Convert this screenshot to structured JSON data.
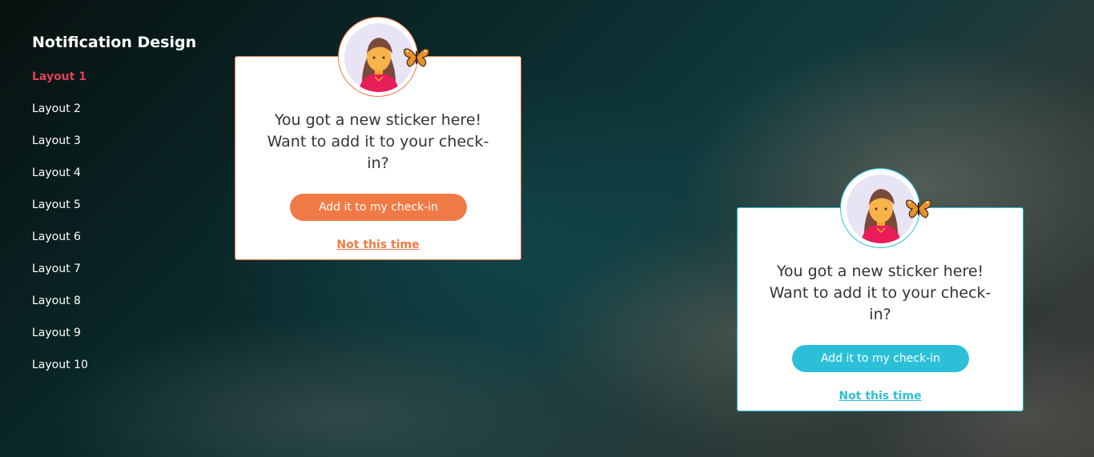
{
  "sidebar": {
    "title": "Notification Design",
    "items": [
      {
        "label": "Layout 1",
        "active": true
      },
      {
        "label": "Layout 2"
      },
      {
        "label": "Layout 3"
      },
      {
        "label": "Layout 4"
      },
      {
        "label": "Layout 5"
      },
      {
        "label": "Layout 6"
      },
      {
        "label": "Layout 7"
      },
      {
        "label": "Layout 8"
      },
      {
        "label": "Layout 9"
      },
      {
        "label": "Layout 10"
      }
    ]
  },
  "cards": [
    {
      "accent": "#f07a45",
      "message": "You got a new sticker here! Want to add it to your check-in?",
      "cta_label": "Add it to my check-in",
      "dismiss_label": "Not this time",
      "avatar_icon": "woman-avatar-icon",
      "sticker_icon": "butterfly-icon"
    },
    {
      "accent": "#2cc0d8",
      "message": "You got a new sticker here! Want to add it to your check-in?",
      "cta_label": "Add it to my check-in",
      "dismiss_label": "Not this time",
      "avatar_icon": "woman-avatar-icon",
      "sticker_icon": "butterfly-icon"
    }
  ],
  "colors": {
    "active_nav": "#e0415a",
    "text_dark": "#333333"
  }
}
